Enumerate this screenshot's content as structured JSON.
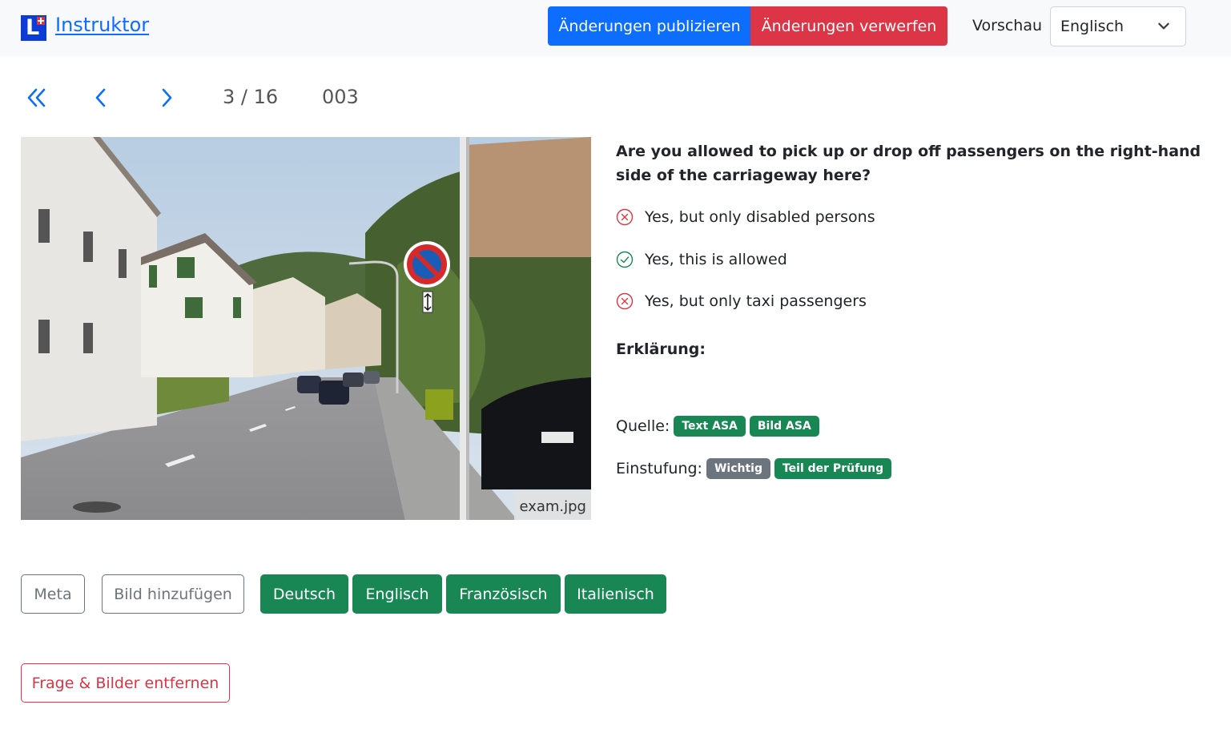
{
  "navbar": {
    "brand": "Instruktor",
    "publish_label": "Änderungen publizieren",
    "discard_label": "Änderungen verwerfen",
    "preview_label": "Vorschau",
    "preview_language": "Englisch"
  },
  "pager": {
    "counter": "3 / 16",
    "question_id": "003"
  },
  "image": {
    "filename": "exam.jpg"
  },
  "question": {
    "text": "Are you allowed to pick up or drop off passengers on the right-hand side of the carriageway here?",
    "answers": [
      {
        "text": "Yes, but only disabled persons",
        "correct": false
      },
      {
        "text": "Yes, this is allowed",
        "correct": true
      },
      {
        "text": "Yes, but only taxi passengers",
        "correct": false
      }
    ],
    "explanation_label": "Erklärung:"
  },
  "source": {
    "label": "Quelle:",
    "badges": [
      "Text ASA",
      "Bild ASA"
    ]
  },
  "rating": {
    "label": "Einstufung:",
    "badges": [
      "Wichtig",
      "Teil der Prüfung"
    ]
  },
  "actions": {
    "meta": "Meta",
    "add_image": "Bild hinzufügen",
    "languages": [
      "Deutsch",
      "Englisch",
      "Französisch",
      "Italienisch"
    ],
    "remove": "Frage & Bilder entfernen"
  },
  "colors": {
    "primary": "#0d6efd",
    "danger": "#dc3545",
    "success": "#198754",
    "secondary": "#6c757d"
  }
}
